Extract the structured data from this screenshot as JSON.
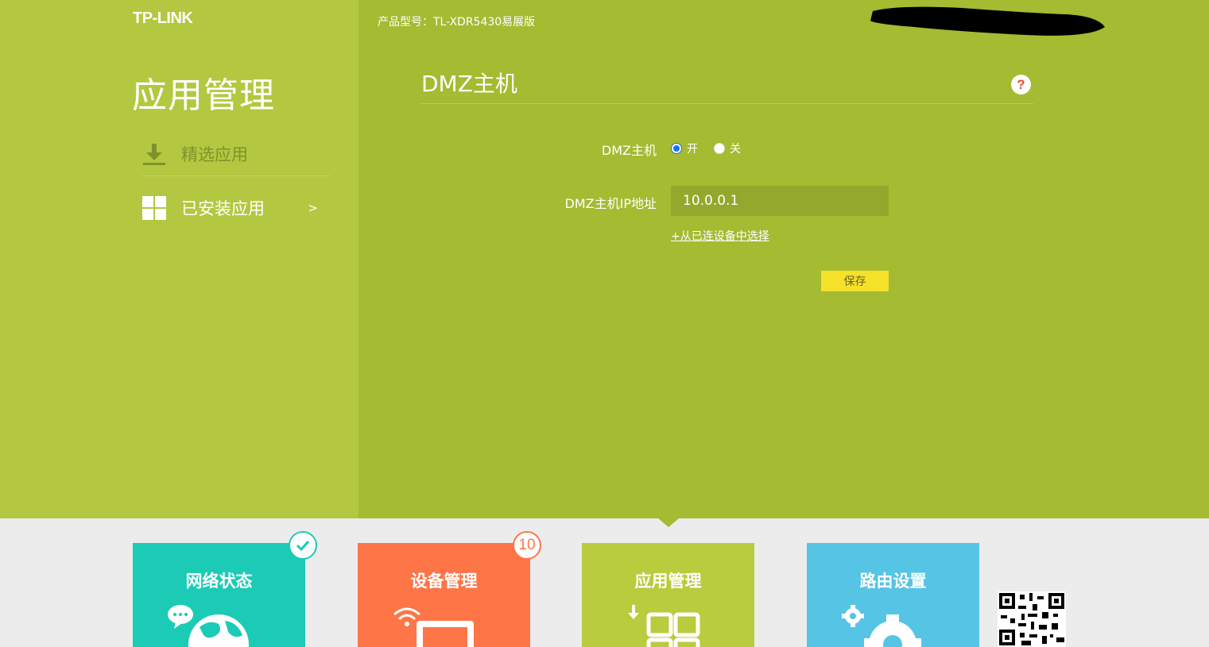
{
  "header": {
    "brand": "TP-LINK",
    "model": "产品型号：TL-XDR5430易展版"
  },
  "sidebar": {
    "title": "应用管理",
    "items": [
      {
        "label": "精选应用",
        "icon": "download-icon"
      },
      {
        "label": "已安装应用",
        "icon": "grid-icon",
        "arrow": ">"
      }
    ]
  },
  "main": {
    "section_title": "DMZ主机",
    "help_icon": "?",
    "dmz_label": "DMZ主机",
    "radio_on": "开",
    "radio_off": "关",
    "radio_selected": "开",
    "ip_label": "DMZ主机IP地址",
    "ip_value": "10.0.0.1",
    "select_link": "+从已连设备中选择",
    "save_label": "保存"
  },
  "bottom_nav": {
    "tiles": [
      {
        "label": "网络状态",
        "color": "#1ccbb5"
      },
      {
        "label": "设备管理",
        "color": "#fe7548"
      },
      {
        "label": "应用管理",
        "color": "#b8cc3d"
      },
      {
        "label": "路由设置",
        "color": "#56c4e5"
      }
    ],
    "device_count": "10"
  },
  "colors": {
    "main_bg": "#a4bb32",
    "sidebar_bg": "#b3c840",
    "save_button": "#f5e12a"
  }
}
